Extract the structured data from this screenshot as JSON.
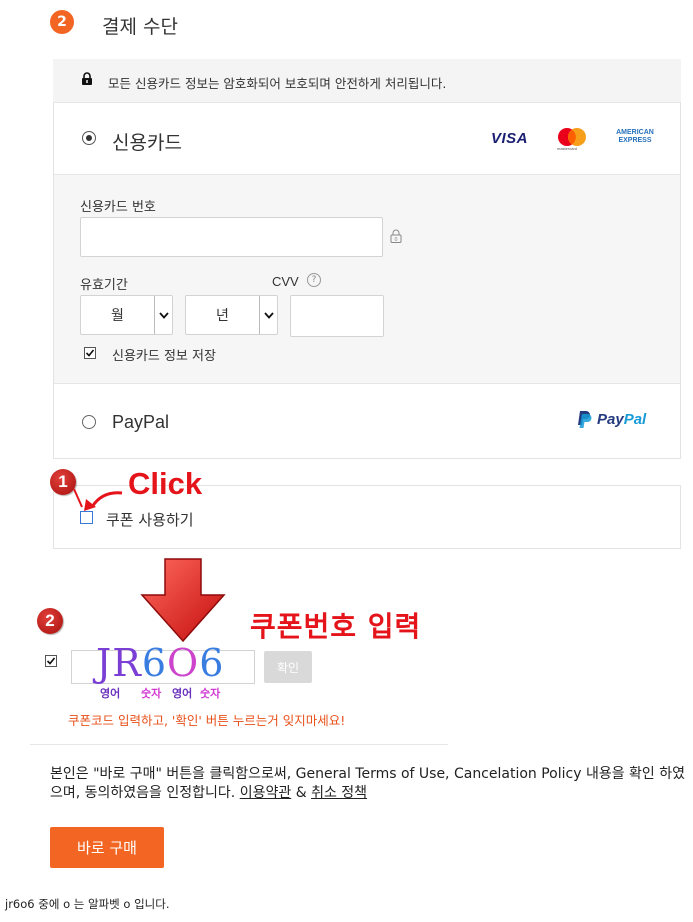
{
  "section": {
    "step_number": "2",
    "title": "결제 수단"
  },
  "payment": {
    "secure_notice": "모든 신용카드 정보는 암호화되어 보호되며 안전하게 처리됩니다.",
    "credit_card_label": "신용카드",
    "card_brands": {
      "visa": "VISA",
      "mastercard": "mastercard",
      "amex_line1": "AMERICAN",
      "amex_line2": "EXPRESS"
    },
    "card_number_label": "신용카드 번호",
    "card_number_value": "",
    "expiry_label": "유효기간",
    "cvv_label": "CVV",
    "cvv_help": "?",
    "month_selected": "월",
    "year_selected": "년",
    "cvv_value": "",
    "save_card_label": "신용카드 정보 저장",
    "save_card_checked": true,
    "paypal_label": "PayPal",
    "paypal_logo_text": {
      "pay": "Pay",
      "pal": "Pal"
    }
  },
  "coupon": {
    "use_coupon_label": "쿠폰 사용하기",
    "code_value": "JR6O6",
    "code_chars": [
      "J",
      "R",
      "6",
      "O",
      "6"
    ],
    "confirm_label": "확인",
    "sub_labels": {
      "eng1": "영어",
      "num1": "숫자",
      "eng2": "영어",
      "num2": "숫자"
    },
    "reminder": "쿠폰코드 입력하고, '확인' 버튼 누르는거 잊지마세요!"
  },
  "annotations": {
    "step1": "1",
    "click_text": "Click",
    "step2": "2",
    "coupon_title": "쿠폰번호 입력"
  },
  "terms": {
    "text": "본인은 \"바로 구매\" 버튼을 클릭함으로써, General Terms of Use, Cancelation Policy 내용을 확인 하였으며, 동의하였음을 인정합니다.",
    "link_terms": "이용약관",
    "amp": "&",
    "link_cancel": "취소 정책"
  },
  "buy_button": "바로 구매",
  "footnote": "jr6o6 중에 o 는 알파벳 o 입니다.",
  "colors": {
    "accent": "#f26522",
    "annotation_red": "#e5141b",
    "reminder_orange": "#e8501a",
    "paypal_dark": "#253b80",
    "paypal_light": "#179bd7",
    "visa_blue": "#1a1f71"
  }
}
